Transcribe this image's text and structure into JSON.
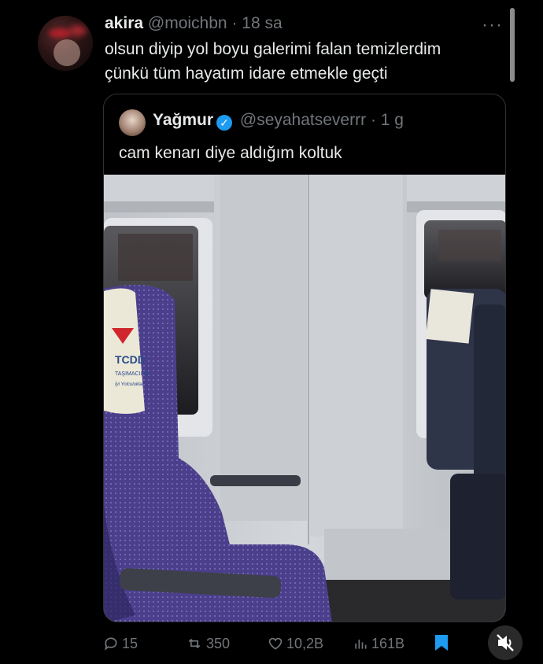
{
  "tweet": {
    "name": "akira",
    "handle": "@moichbn",
    "separator": "·",
    "time": "18 sa",
    "more_icon": "more-horizontal-icon",
    "text_lines": [
      "olsun diyip yol boyu galerimi falan temizlerdim",
      "çünkü tüm hayatım idare etmekle geçti"
    ]
  },
  "quote": {
    "name": "Yağmur",
    "verified_icon": "verified-badge-icon",
    "handle": "@seyahatseverrr",
    "separator": "·",
    "time": "1 g",
    "text": "cam kenarı diye aldığım koltuk",
    "photo": {
      "headrest_logo": "TCDD",
      "headrest_sub": "TAŞIMACILIK",
      "headrest_tagline": "İyi Yolculuklar"
    }
  },
  "actions": {
    "replies": "15",
    "reposts": "350",
    "likes": "10,2B",
    "views": "161B"
  },
  "colors": {
    "background": "#000000",
    "text": "#e7e9ea",
    "muted": "#71767b",
    "accent": "#1d9bf0",
    "seat": "#4a3d8a"
  }
}
